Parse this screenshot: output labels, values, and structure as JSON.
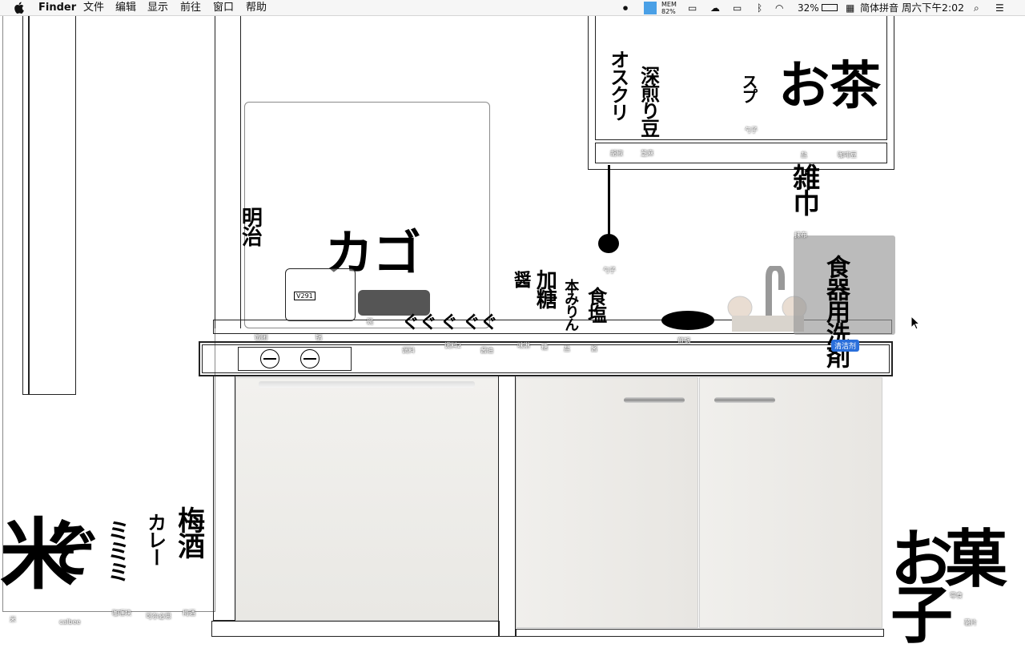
{
  "menubar": {
    "app_name": "Finder",
    "menus": [
      "文件",
      "编辑",
      "显示",
      "前往",
      "窗口",
      "帮助"
    ],
    "mem_label": "MEM",
    "mem_value": "82%",
    "battery": "32%",
    "input_method": "简体拼音",
    "clock": "周六下午2:02"
  },
  "desktop": {
    "selected_item_label": "清洁剂",
    "glyphs": {
      "top_shelf_1": "オスクリ",
      "top_shelf_2": "深煎り豆",
      "top_shelf_3": "スプ",
      "top_shelf_big": "お茶",
      "hanging": "雑巾",
      "cleaner": "食器用洗剤",
      "stove_bag": "明治",
      "kettle": "カゴ",
      "bottle_1": "醤",
      "bottle_2": "加糖",
      "bottle_3": "本みりん",
      "bottle_4": "食塩",
      "left_big": "米",
      "left_2": "ミミミ",
      "left_3": "カレー",
      "left_4": "梅酒",
      "right_big": "お菓子",
      "pan_small": "ぐ"
    },
    "labels": {
      "shelf_a": "胡椒",
      "shelf_b": "芝麻",
      "shelf_c": "勺子",
      "shelf_d": "盐",
      "shelf_e": "咖啡豆",
      "hang_label": "抹布",
      "ladle": "勺子",
      "bag": "饭团",
      "kettle": "锅",
      "pot": "碗",
      "spice_1": "调料",
      "spice_2": "调料2",
      "spice_3": "酱油",
      "spice_4": "味淋",
      "spice_5": "糖",
      "spice_6": "盐",
      "spice_7": "酱",
      "pan": "煎锅",
      "left_1": "米",
      "left_2": "calbee",
      "left_3": "咖喱块",
      "left_4": "可尔必思",
      "left_5": "梅酒",
      "right_1": "零食",
      "right_2": "薯片"
    }
  },
  "colors": {
    "selection_blue": "#2a6fdb",
    "selection_gray": "#9a9a9a"
  }
}
